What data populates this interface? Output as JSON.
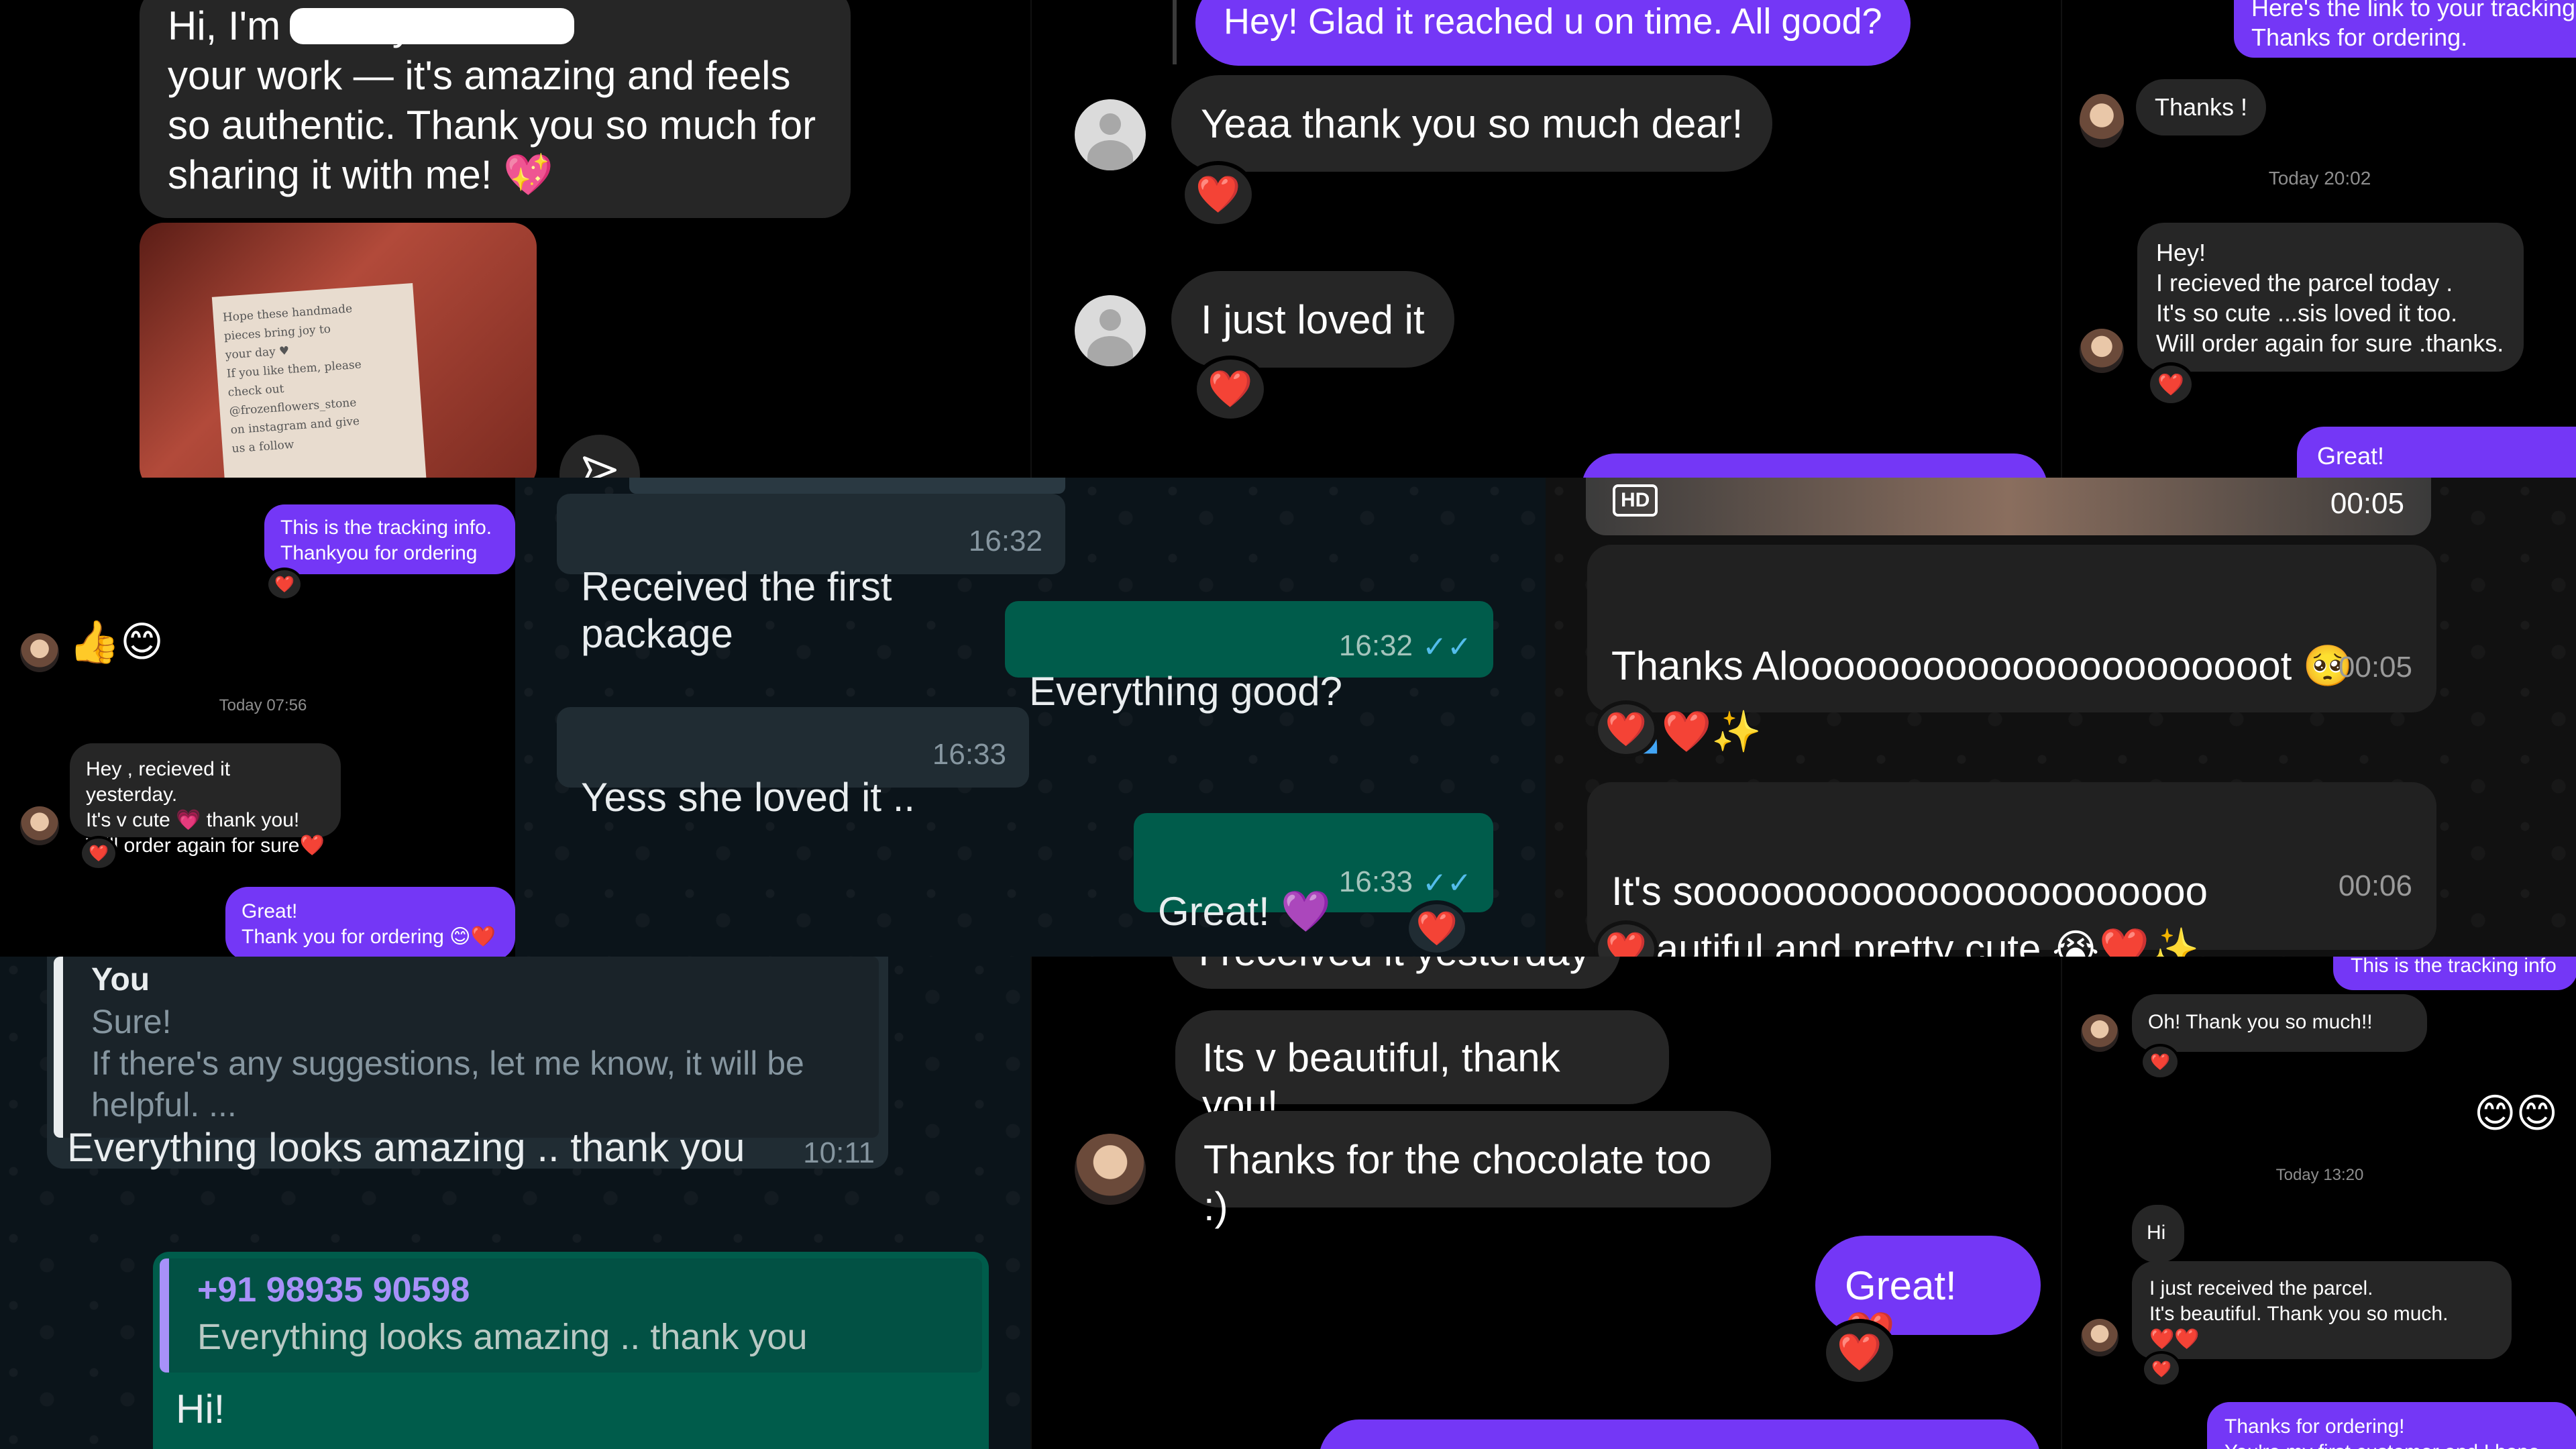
{
  "colors": {
    "ig_purple": "#7437f6",
    "ig_gray": "#262626",
    "wa_in": "#202c33",
    "wa_out": "#005c4b",
    "wa_tick_blue": "#53bdeb",
    "heart": "#e0112b"
  },
  "p1": {
    "message": "Hi, I'm                          . I truly loved\nyour work — it's amazing and feels\nso authentic. Thank you so much for\nsharing it with me! 💖",
    "note_lines": [
      "Hope these handmade",
      "pieces bring joy to",
      "your day ♥",
      "If you like them, please",
      "check out",
      "@frozenflowers_stone",
      "on instagram and give",
      "us a follow"
    ],
    "send_icon": "paper-plane-icon"
  },
  "p2": {
    "out1": "Hey! Glad it reached u on time. All good?",
    "in1": "Yeaa thank you so much dear!",
    "in2": "I just loved it",
    "react": "❤️"
  },
  "p3": {
    "top_out": "Here's the link to your tracking\nThanks for ordering.",
    "in1": "Thanks !",
    "timestamp": "Today 20:02",
    "in2": "Hey!\nI recieved the parcel today .\nIt's so cute ...sis loved it too.\nWill order again for sure .thanks.",
    "out1": "Great!",
    "react": "❤️"
  },
  "p4": {
    "out1": "This is the tracking info.\nThankyou for ordering",
    "emoji": "👍😊",
    "timestamp": "Today 07:56",
    "in1": "Hey , recieved it yesterday.\nIt's v cute 💗 thank you!\nWill order again for sure❤️",
    "out2": "Great!\nThank you for ordering 😊❤️",
    "react": "❤️"
  },
  "p5": {
    "msgs": [
      {
        "dir": "in",
        "text": "Received the first package",
        "time": "16:32"
      },
      {
        "dir": "out",
        "text": "Everything good?",
        "time": "16:32"
      },
      {
        "dir": "in",
        "text": "Yess she loved it ..",
        "time": "16:33"
      },
      {
        "dir": "out",
        "text": "Great! 💜",
        "time": "16:33"
      }
    ],
    "react": "❤️"
  },
  "p6": {
    "video_badge": "HD",
    "video_time": "00:05",
    "msg1": "Thanks Aloooooooooooooooooooooot 🥺\n🫂❤️✨",
    "msg1_time": "00:05",
    "msg2": "It's sooooooooooooooooooooooo\nbeautiful and pretty cute 😭❤️✨",
    "msg2_time": "00:06",
    "react": "❤️"
  },
  "p7": {
    "quote_author": "You",
    "quote_text": "Sure!\nIf there's any suggestions, let me know, it will be\nhelpful. ...",
    "reply": "Everything looks amazing .. thank you",
    "reply_time": "10:11",
    "fwd_author": "+91 98935 90598",
    "fwd_quote": "Everything looks amazing .. thank you",
    "fwd_text": "Hi!"
  },
  "p8": {
    "in0": "I received it yesterday",
    "in1": "Its v beautiful, thank you!",
    "in2": "Thanks for the chocolate too :)",
    "out1": "Great! ❤️",
    "react": "❤️"
  },
  "p9": {
    "top_out": "This is the tracking info",
    "in1": "Oh! Thank you so much!!",
    "emoji": "😊😊",
    "timestamp": "Today 13:20",
    "in2": "Hi",
    "in3": "I just received the parcel.\nIt's beautiful. Thank you so much.\n❤️❤️",
    "out1": "Thanks for ordering!\nYou're my first customer and I hope",
    "react": "❤️"
  }
}
